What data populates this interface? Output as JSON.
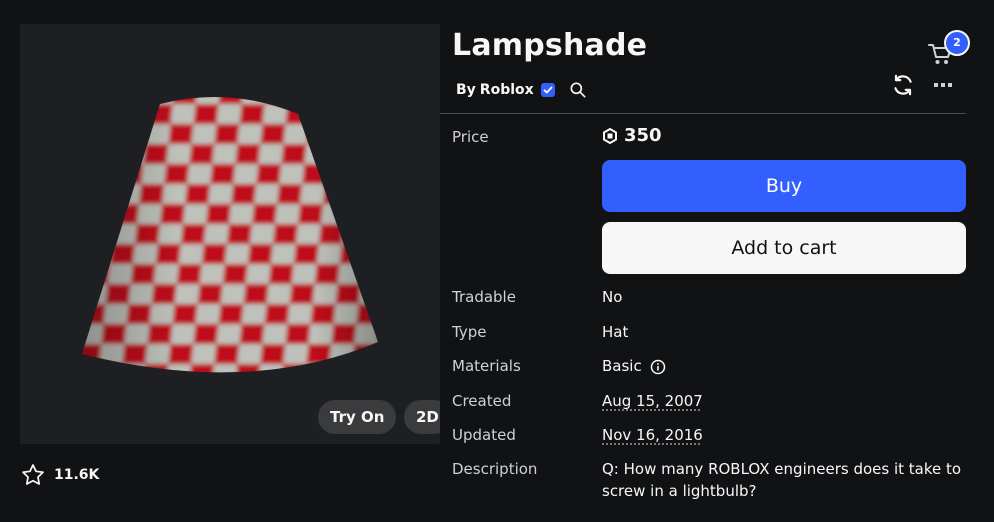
{
  "item": {
    "name": "Lampshade",
    "creator_prefix": "By",
    "creator": "Roblox",
    "favorites": "11.6K"
  },
  "preview": {
    "try_on_label": "Try On",
    "view_2d_label": "2D"
  },
  "cart": {
    "badge_count": "2"
  },
  "details": {
    "price_label": "Price",
    "price_value": "350",
    "buy_label": "Buy",
    "add_to_cart_label": "Add to cart",
    "tradable_label": "Tradable",
    "tradable_value": "No",
    "type_label": "Type",
    "type_value": "Hat",
    "materials_label": "Materials",
    "materials_value": "Basic",
    "created_label": "Created",
    "created_value": "Aug 15, 2007",
    "updated_label": "Updated",
    "updated_value": "Nov 16, 2016",
    "description_label": "Description",
    "description_value": "Q: How many ROBLOX engineers does it take to screw in a lightbulb?"
  },
  "colors": {
    "accent": "#335fff",
    "background": "#111214",
    "preview_bg": "#1e1f22",
    "shade_red": "#c8101a",
    "shade_white": "#c9ccc5"
  }
}
